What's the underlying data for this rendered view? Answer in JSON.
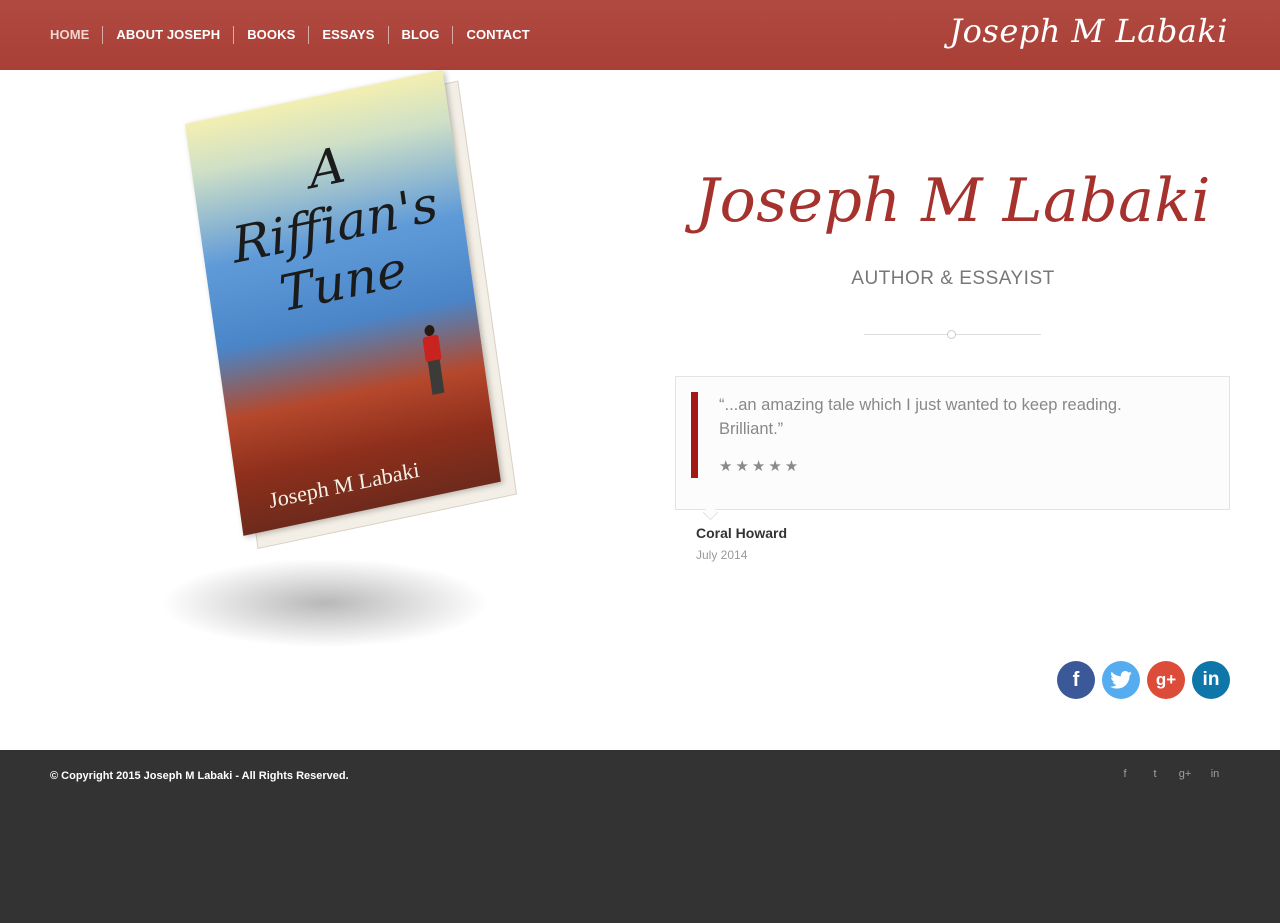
{
  "header": {
    "brand": "Joseph M Labaki",
    "nav": [
      {
        "label": "HOME"
      },
      {
        "label": "ABOUT JOSEPH"
      },
      {
        "label": "BOOKS"
      },
      {
        "label": "ESSAYS"
      },
      {
        "label": "BLOG"
      },
      {
        "label": "CONTACT"
      }
    ]
  },
  "book": {
    "title_line1": "A",
    "title_line2": "Riffian's",
    "title_line3": "Tune",
    "author": "Joseph M Labaki"
  },
  "hero": {
    "name": "Joseph M Labaki",
    "subtitle": "AUTHOR & ESSAYIST"
  },
  "testimonial": {
    "quote": "“...an amazing tale which I just wanted to keep reading. Brilliant.”",
    "stars": "★★★★★",
    "rating": 5,
    "author": "Coral Howard",
    "date": "July 2014"
  },
  "social": {
    "facebook": "f",
    "twitter": "🐦",
    "googleplus": "g+",
    "linkedin": "in"
  },
  "footer": {
    "copyright": "© Copyright 2015 Joseph M Labaki - All Rights Reserved.",
    "social": {
      "facebook": "f",
      "twitter": "t",
      "googleplus": "g+",
      "linkedin": "in"
    }
  },
  "colors": {
    "header_bg": "#ab423a",
    "accent_red": "#a41717",
    "footer_bg": "#333333"
  }
}
